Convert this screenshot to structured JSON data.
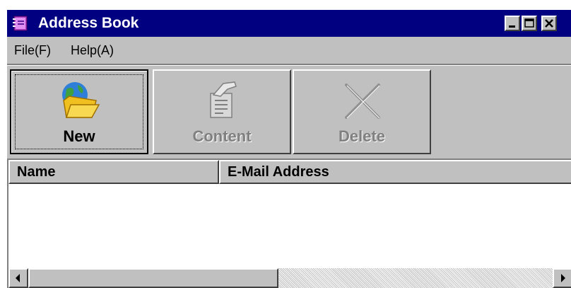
{
  "window": {
    "title": "Address Book",
    "title_bar_color": "#000080",
    "controls": [
      "minimize-icon",
      "maximize-icon",
      "close-icon"
    ]
  },
  "menu": {
    "file_label": "File(F)",
    "help_label": "Help(A)"
  },
  "toolbar": {
    "new_label": "New",
    "content_label": "Content",
    "delete_label": "Delete",
    "icons": [
      "globe-folder-icon",
      "document-hand-icon",
      "cross-icon"
    ]
  },
  "list": {
    "columns": [
      "Name",
      "E-Mail Address"
    ],
    "rows": []
  }
}
